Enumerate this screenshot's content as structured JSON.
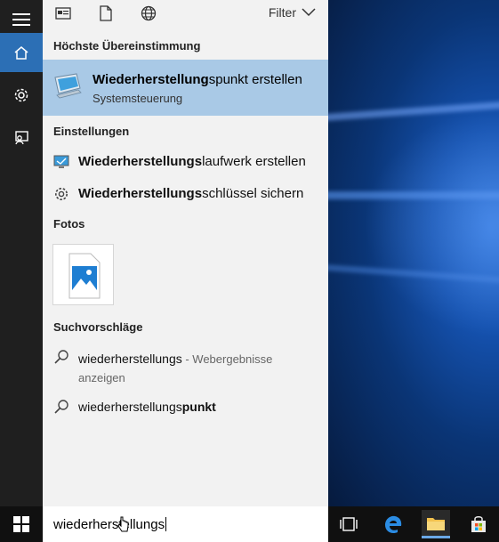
{
  "filter": {
    "label": "Filter"
  },
  "sections": {
    "best_match": "Höchste Übereinstimmung",
    "settings": "Einstellungen",
    "photos": "Fotos",
    "suggestions": "Suchvorschläge"
  },
  "best_match": {
    "title_bold": "Wiederherstellung",
    "title_rest": "spunkt erstellen",
    "subtitle": "Systemsteuerung"
  },
  "settings_items": [
    {
      "bold": "Wiederherstellungs",
      "rest": "laufwerk erstellen",
      "icon": "monitor-icon"
    },
    {
      "bold": "Wiederherstellungs",
      "rest": "schlüssel sichern",
      "icon": "gear-icon"
    }
  ],
  "suggestions": [
    {
      "text": "wiederherstellungs",
      "suffix": " - Webergebnisse",
      "suffix2": "anzeigen"
    },
    {
      "text": "wiederherstellungs",
      "bold": "punkt"
    }
  ],
  "search": {
    "query": "wiederherstellungs"
  },
  "colors": {
    "accent": "#2c6fb5",
    "selected": "#a9c9e6",
    "panel": "#f2f2f2",
    "rail": "#1f1f1f"
  }
}
